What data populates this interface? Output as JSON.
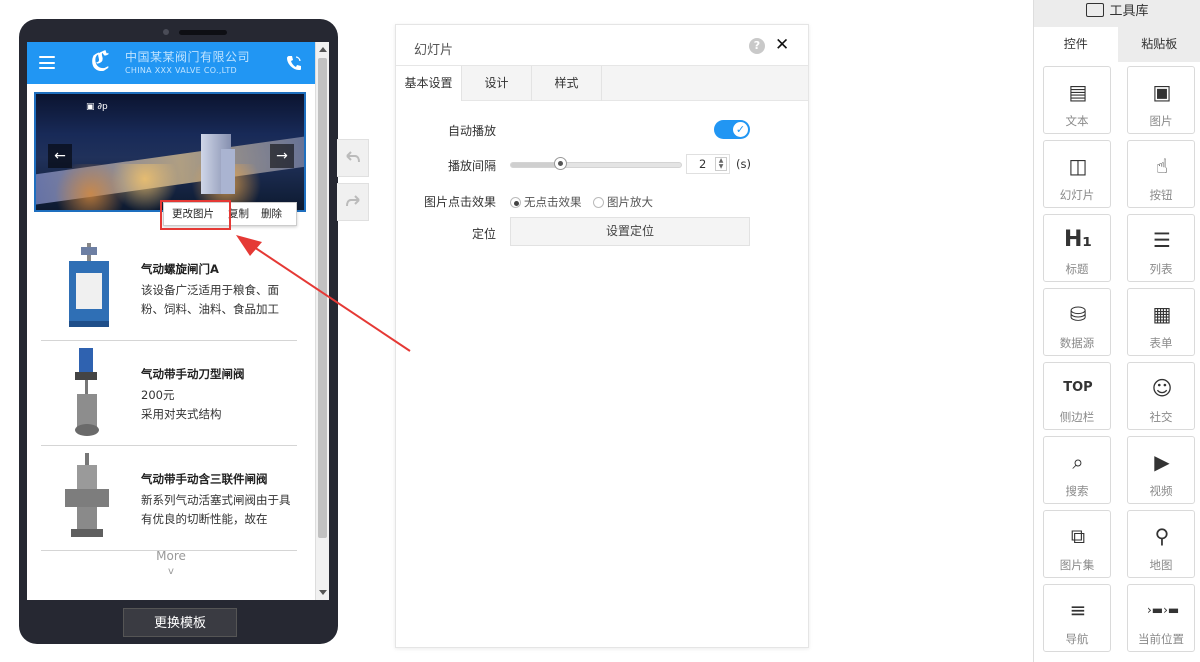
{
  "phone": {
    "company_cn": "中国某某阀门有限公司",
    "company_en": "CHINA XXX VALVE CO.,LTD",
    "image_toolbar": [
      "更改图片",
      "复制",
      "删除"
    ],
    "products": [
      {
        "title": "气动螺旋闸门A",
        "desc": "该设备广泛适用于粮食、面粉、饲料、油料、食品加工"
      },
      {
        "title": "气动带手动刀型闸阀",
        "desc": "200元\n采用对夹式结构"
      },
      {
        "title": "气动带手动含三联件闸阀",
        "desc": "新系列气动活塞式闸阀由于具有优良的切断性能，故在"
      }
    ],
    "more": "More",
    "more_chevron": "v",
    "template_button": "更换模板"
  },
  "panel": {
    "title": "幻灯片",
    "help": "?",
    "close": "✕",
    "tabs": [
      "基本设置",
      "设计",
      "样式"
    ],
    "autoplay_label": "自动播放",
    "autoplay_on": true,
    "interval_label": "播放间隔",
    "interval_value": "2",
    "interval_unit": "(s)",
    "click_effect_label": "图片点击效果",
    "click_options": [
      "无点击效果",
      "图片放大"
    ],
    "click_selected": "无点击效果",
    "position_label": "定位",
    "position_button": "设置定位"
  },
  "toolbox": {
    "title": "工具库",
    "tabs": [
      "控件",
      "粘贴板"
    ],
    "items": [
      {
        "label": "文本",
        "icon": "text-icon"
      },
      {
        "label": "图片",
        "icon": "image-icon"
      },
      {
        "label": "幻灯片",
        "icon": "slideshow-icon"
      },
      {
        "label": "按钮",
        "icon": "button-icon"
      },
      {
        "label": "标题",
        "icon": "heading-icon"
      },
      {
        "label": "列表",
        "icon": "list-icon"
      },
      {
        "label": "数据源",
        "icon": "datasource-icon"
      },
      {
        "label": "表单",
        "icon": "form-icon"
      },
      {
        "label": "侧边栏",
        "icon": "sidebar-icon"
      },
      {
        "label": "社交",
        "icon": "social-icon"
      },
      {
        "label": "搜索",
        "icon": "search-icon"
      },
      {
        "label": "视频",
        "icon": "video-icon"
      },
      {
        "label": "图片集",
        "icon": "gallery-icon"
      },
      {
        "label": "地图",
        "icon": "map-icon"
      },
      {
        "label": "导航",
        "icon": "nav-icon"
      },
      {
        "label": "当前位置",
        "icon": "breadcrumb-icon"
      }
    ]
  },
  "colors": {
    "accent": "#2196f3",
    "annotation_red": "#e53935",
    "phone_body": "#262832"
  }
}
